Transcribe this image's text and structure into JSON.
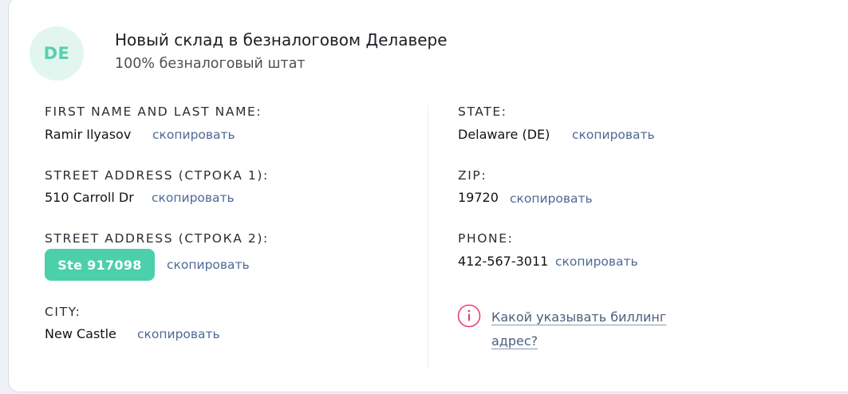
{
  "header": {
    "avatar_text": "DE",
    "title": "Новый склад в безналоговом Делавере",
    "subtitle": "100% безналоговый штат"
  },
  "copy_label": "скопировать",
  "left_fields": [
    {
      "label": "FIRST NAME AND LAST NAME:",
      "value": "Ramir Ilyasov"
    },
    {
      "label": "STREET ADDRESS (СТРОКА 1):",
      "value": "510 Carroll Dr"
    },
    {
      "label": "STREET ADDRESS (СТРОКА 2):",
      "value": "Ste 917098"
    },
    {
      "label": "CITY:",
      "value": "New Castle"
    }
  ],
  "right_fields": [
    {
      "label": "STATE:",
      "value": "Delaware (DE)"
    },
    {
      "label": "ZIP:",
      "value": "19720"
    },
    {
      "label": "PHONE:",
      "value": "412-567-3011"
    }
  ],
  "billing_help": {
    "icon": "info-icon",
    "text": "Какой указывать биллинг адрес?"
  },
  "colors": {
    "accent": "#4ccfab",
    "avatar_bg": "#e2f6ef",
    "link": "#4c6a94",
    "info_icon": "#e8407a"
  }
}
